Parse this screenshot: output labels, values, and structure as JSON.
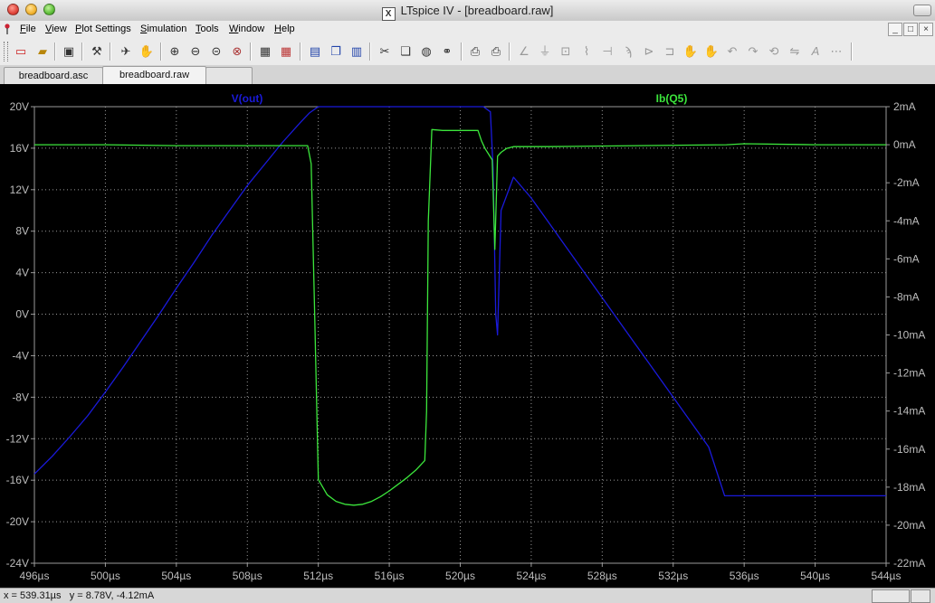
{
  "window": {
    "title": "LTspice IV - [breadboard.raw]",
    "app_icon_glyph": "X"
  },
  "menu": {
    "items": [
      "File",
      "View",
      "Plot Settings",
      "Simulation",
      "Tools",
      "Window",
      "Help"
    ],
    "controls": [
      "_",
      "□",
      "×"
    ]
  },
  "toolbar": {
    "icons": [
      "new-schematic-icon",
      "open-icon",
      "save-icon",
      "control-panel-icon",
      "run-icon",
      "halt-icon",
      "zoom-in-icon",
      "zoom-out-icon",
      "zoom-back-icon",
      "zoom-cancel-icon",
      "autorange-icon",
      "manual-limits-icon",
      "tile-horizontal-icon",
      "cascade-icon",
      "tile-vertical-icon",
      "cut-icon",
      "copy-icon",
      "find-icon",
      "print-preview-icon",
      "print-icon",
      "wire-icon",
      "ground-icon",
      "label-icon",
      "resistor-icon",
      "capacitor-icon",
      "inductor-icon",
      "diode-icon",
      "component-icon",
      "move-icon",
      "drag-icon",
      "undo-icon",
      "redo-icon",
      "rotate-icon",
      "mirror-icon",
      "text-icon",
      "spice-directive-icon"
    ]
  },
  "tabs": [
    {
      "label": "breadboard.asc",
      "active": false
    },
    {
      "label": "breadboard.raw",
      "active": true
    },
    {
      "label": "",
      "active": false
    }
  ],
  "status": {
    "x_readout": "x = 539.31µs",
    "y_readout": "y = 8.78V, -4.12mA"
  },
  "chart_data": {
    "type": "line",
    "background": "#000000",
    "grid": true,
    "x_ticks": [
      "496µs",
      "500µs",
      "504µs",
      "508µs",
      "512µs",
      "516µs",
      "520µs",
      "524µs",
      "528µs",
      "532µs",
      "536µs",
      "540µs",
      "544µs"
    ],
    "xlim": [
      496,
      544
    ],
    "left_axis": {
      "ticks": [
        "20V",
        "16V",
        "12V",
        "8V",
        "4V",
        "0V",
        "-4V",
        "-8V",
        "-12V",
        "-16V",
        "-20V",
        "-24V"
      ],
      "ylim": [
        -24,
        20
      ]
    },
    "right_axis": {
      "ticks": [
        "2mA",
        "0mA",
        "-2mA",
        "-4mA",
        "-6mA",
        "-8mA",
        "-10mA",
        "-12mA",
        "-14mA",
        "-16mA",
        "-18mA",
        "-20mA",
        "-22mA"
      ],
      "ylim": [
        -22,
        2
      ]
    },
    "series": [
      {
        "name": "V(out)",
        "axis": "left",
        "color": "#1a1adb",
        "x": [
          496,
          497,
          498,
          499,
          500,
          501,
          502,
          503,
          504,
          505,
          506,
          507,
          508,
          509,
          510,
          511,
          511.5,
          512,
          514,
          516,
          518,
          520,
          521.3,
          521.7,
          521.85,
          522,
          522.1,
          522.3,
          523,
          524,
          525,
          526,
          527,
          528,
          529,
          530,
          531,
          532,
          533,
          534,
          534.9,
          536,
          538,
          540,
          542,
          544
        ],
        "y": [
          -15.4,
          -13.7,
          -11.8,
          -9.8,
          -7.5,
          -5.1,
          -2.6,
          -0.1,
          2.5,
          5.0,
          7.6,
          10.0,
          12.4,
          14.5,
          16.6,
          18.5,
          19.4,
          20,
          20,
          20,
          20,
          20,
          20,
          19.5,
          14,
          0,
          -2,
          10,
          13.2,
          11.2,
          8.8,
          6.4,
          4.0,
          1.6,
          -0.8,
          -3.2,
          -5.6,
          -8.0,
          -10.4,
          -12.8,
          -17.5,
          -17.5,
          -17.5,
          -17.5,
          -17.5,
          -17.5
        ]
      },
      {
        "name": "Ib(Q5)",
        "axis": "right",
        "color": "#3ce63c",
        "x": [
          496,
          500,
          504,
          508,
          511.4,
          511.6,
          511.8,
          512,
          512.5,
          513,
          513.5,
          514,
          514.5,
          515,
          515.5,
          516,
          516.5,
          517,
          517.5,
          518,
          518.1,
          518.2,
          518.4,
          519,
          520,
          521,
          521.2,
          521.4,
          521.6,
          521.8,
          521.95,
          522.1,
          522.3,
          522.6,
          523,
          525,
          530,
          535,
          536,
          540,
          544
        ],
        "y": [
          0.0,
          0.0,
          -0.05,
          -0.05,
          -0.05,
          -1,
          -9,
          -17.6,
          -18.4,
          -18.75,
          -18.9,
          -18.95,
          -18.9,
          -18.75,
          -18.5,
          -18.2,
          -17.85,
          -17.5,
          -17.1,
          -16.6,
          -14,
          -4,
          0.8,
          0.75,
          0.75,
          0.75,
          0.2,
          -0.2,
          -0.5,
          -0.8,
          -5.5,
          -0.6,
          -0.4,
          -0.2,
          -0.1,
          -0.1,
          -0.05,
          0.0,
          0.05,
          0.0,
          0.0
        ]
      }
    ]
  }
}
